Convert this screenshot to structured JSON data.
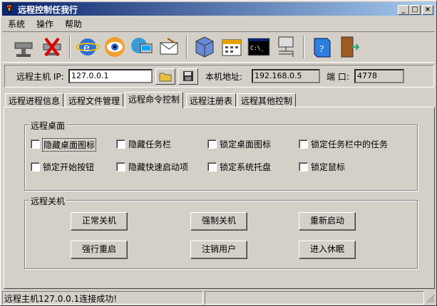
{
  "window": {
    "title": "远程控制任我行"
  },
  "menu": [
    "系统",
    "操作",
    "帮助"
  ],
  "toolbar": {
    "buttons": [
      "connect-icon",
      "disconnect-icon",
      "ie-browser-icon",
      "eye-view-icon",
      "network-icon",
      "message-icon",
      "cube-tools-icon",
      "calendar-icon",
      "command-prompt-icon",
      "network-tree-icon",
      "help-book-icon",
      "exit-door-icon"
    ],
    "cmd_text": "C:\\_"
  },
  "address": {
    "remote_label": "远程主机 IP:",
    "remote_ip": "127.0.0.1",
    "local_label": "本机地址:",
    "local_ip": "192.168.0.5",
    "port_label": "端 口:",
    "port": "4778"
  },
  "tabs": [
    "远程进程信息",
    "远程文件管理",
    "远程命令控制",
    "远程注册表",
    "远程其他控制"
  ],
  "active_tab": 2,
  "desktop_group": {
    "title": "远程桌面",
    "options": [
      "隐藏桌面图标",
      "隐藏任务栏",
      "锁定桌面图标",
      "锁定任务栏中的任务",
      "锁定开始按钮",
      "隐藏快速启动项",
      "锁定系统托盘",
      "锁定鼠标"
    ]
  },
  "shutdown_group": {
    "title": "远程关机",
    "buttons": [
      "正常关机",
      "强制关机",
      "重新启动",
      "强行重启",
      "注销用户",
      "进入休眠"
    ]
  },
  "status": {
    "text": "远程主机127.0.0.1连接成功!"
  },
  "colors": {
    "title_start": "#0a246a",
    "title_end": "#a6caf0",
    "face": "#d4d0c8"
  }
}
